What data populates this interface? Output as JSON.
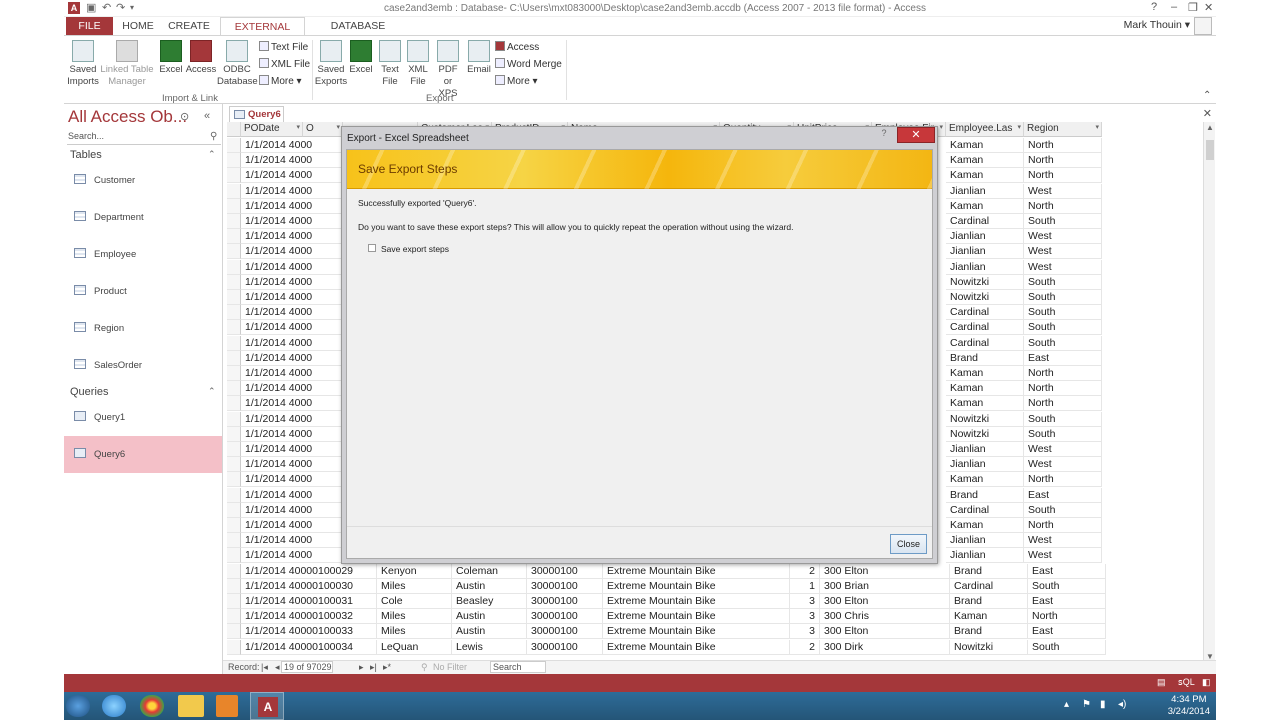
{
  "window": {
    "title": "case2and3emb : Database- C:\\Users\\mxt083000\\Desktop\\case2and3emb.accdb (Access 2007 - 2013 file format) - Access",
    "app_icon": "A",
    "help": "?",
    "min": "–",
    "restore": "❐",
    "close": "✕"
  },
  "ribbon_tabs": [
    {
      "label": "FILE"
    },
    {
      "label": "HOME"
    },
    {
      "label": "CREATE"
    },
    {
      "label": "EXTERNAL DATA"
    },
    {
      "label": "DATABASE TOOLS"
    }
  ],
  "user": {
    "name": "Mark Thouin ▾"
  },
  "ribbon": {
    "import": {
      "saved_imports": "Saved Imports",
      "linked_table_manager": "Linked Table Manager",
      "excel": "Excel",
      "access": "Access",
      "odbc": "ODBC Database",
      "text_file": "Text File",
      "xml_file": "XML File",
      "more": "More ▾",
      "group_label": "Import & Link"
    },
    "export": {
      "saved_exports": "Saved Exports",
      "excel": "Excel",
      "text_file": "Text File",
      "xml_file": "XML File",
      "pdf": "PDF or XPS",
      "email": "Email",
      "access": "Access",
      "word_merge": "Word Merge",
      "more": "More ▾",
      "group_label": "Export"
    }
  },
  "nav": {
    "header": "All Access Ob...",
    "search_placeholder": "Search...",
    "tables_label": "Tables",
    "tables": [
      "Customer",
      "Department",
      "Employee",
      "Product",
      "Region",
      "SalesOrder"
    ],
    "queries_label": "Queries",
    "queries": [
      "Query1",
      "Query6"
    ],
    "selected": "Query6"
  },
  "doc_tab": {
    "label": "Query6"
  },
  "grid": {
    "headers": [
      "PODate",
      "O",
      "",
      "Customer.Las",
      "ProductID",
      "Name",
      "Quantity",
      "UnitPrice",
      "Employee.Fir",
      "Employee.Las",
      "Region"
    ],
    "rows": [
      [
        "1/1/2014 4000",
        "",
        "",
        "",
        "",
        "",
        "",
        "",
        "",
        "Kaman",
        "North"
      ],
      [
        "1/1/2014 4000",
        "",
        "",
        "",
        "",
        "",
        "",
        "",
        "",
        "Kaman",
        "North"
      ],
      [
        "1/1/2014 4000",
        "",
        "",
        "",
        "",
        "",
        "",
        "",
        "",
        "Kaman",
        "North"
      ],
      [
        "1/1/2014 4000",
        "",
        "",
        "",
        "",
        "",
        "",
        "",
        "",
        "Jianlian",
        "West"
      ],
      [
        "1/1/2014 4000",
        "",
        "",
        "",
        "",
        "",
        "",
        "",
        "",
        "Kaman",
        "North"
      ],
      [
        "1/1/2014 4000",
        "",
        "",
        "",
        "",
        "",
        "",
        "",
        "",
        "Cardinal",
        "South"
      ],
      [
        "1/1/2014 4000",
        "",
        "",
        "",
        "",
        "",
        "",
        "",
        "",
        "Jianlian",
        "West"
      ],
      [
        "1/1/2014 4000",
        "",
        "",
        "",
        "",
        "",
        "",
        "",
        "",
        "Jianlian",
        "West"
      ],
      [
        "1/1/2014 4000",
        "",
        "",
        "",
        "",
        "",
        "",
        "",
        "",
        "Jianlian",
        "West"
      ],
      [
        "1/1/2014 4000",
        "",
        "",
        "",
        "",
        "",
        "",
        "",
        "",
        "Nowitzki",
        "South"
      ],
      [
        "1/1/2014 4000",
        "",
        "",
        "",
        "",
        "",
        "",
        "",
        "",
        "Nowitzki",
        "South"
      ],
      [
        "1/1/2014 4000",
        "",
        "",
        "",
        "",
        "",
        "",
        "",
        "",
        "Cardinal",
        "South"
      ],
      [
        "1/1/2014 4000",
        "",
        "",
        "",
        "",
        "",
        "",
        "",
        "",
        "Cardinal",
        "South"
      ],
      [
        "1/1/2014 4000",
        "",
        "",
        "",
        "",
        "",
        "",
        "",
        "",
        "Cardinal",
        "South"
      ],
      [
        "1/1/2014 4000",
        "",
        "",
        "",
        "",
        "",
        "",
        "",
        "",
        "Brand",
        "East"
      ],
      [
        "1/1/2014 4000",
        "",
        "",
        "",
        "",
        "",
        "",
        "",
        "",
        "Kaman",
        "North"
      ],
      [
        "1/1/2014 4000",
        "",
        "",
        "",
        "",
        "",
        "",
        "",
        "",
        "Kaman",
        "North"
      ],
      [
        "1/1/2014 4000",
        "",
        "",
        "",
        "",
        "",
        "",
        "",
        "",
        "Kaman",
        "North"
      ],
      [
        "1/1/2014 4000",
        "",
        "",
        "",
        "",
        "",
        "",
        "",
        "",
        "Nowitzki",
        "South"
      ],
      [
        "1/1/2014 4000",
        "",
        "",
        "",
        "",
        "",
        "",
        "",
        "",
        "Nowitzki",
        "South"
      ],
      [
        "1/1/2014 4000",
        "",
        "",
        "",
        "",
        "",
        "",
        "",
        "",
        "Jianlian",
        "West"
      ],
      [
        "1/1/2014 4000",
        "",
        "",
        "",
        "",
        "",
        "",
        "",
        "",
        "Jianlian",
        "West"
      ],
      [
        "1/1/2014 4000",
        "",
        "",
        "",
        "",
        "",
        "",
        "",
        "",
        "Kaman",
        "North"
      ],
      [
        "1/1/2014 4000",
        "",
        "",
        "",
        "",
        "",
        "",
        "",
        "",
        "Brand",
        "East"
      ],
      [
        "1/1/2014 4000",
        "",
        "",
        "",
        "",
        "",
        "",
        "",
        "",
        "Cardinal",
        "South"
      ],
      [
        "1/1/2014 4000",
        "",
        "",
        "",
        "",
        "",
        "",
        "",
        "",
        "Kaman",
        "North"
      ],
      [
        "1/1/2014 4000",
        "",
        "",
        "",
        "",
        "",
        "",
        "",
        "",
        "Jianlian",
        "West"
      ],
      [
        "1/1/2014 4000",
        "",
        "",
        "",
        "",
        "",
        "",
        "",
        "",
        "Jianlian",
        "West"
      ],
      [
        "1/1/2014 40000100029",
        "Kenyon",
        "Coleman",
        "30000100",
        "Extreme Mountain Bike",
        "2",
        "300",
        "Elton",
        "Brand",
        "East",
        ""
      ],
      [
        "1/1/2014 40000100030",
        "Miles",
        "Austin",
        "30000100",
        "Extreme Mountain Bike",
        "1",
        "300",
        "Brian",
        "Cardinal",
        "South",
        ""
      ],
      [
        "1/1/2014 40000100031",
        "Cole",
        "Beasley",
        "30000100",
        "Extreme Mountain Bike",
        "3",
        "300",
        "Elton",
        "Brand",
        "East",
        ""
      ],
      [
        "1/1/2014 40000100032",
        "Miles",
        "Austin",
        "30000100",
        "Extreme Mountain Bike",
        "3",
        "300",
        "Chris",
        "Kaman",
        "North",
        ""
      ],
      [
        "1/1/2014 40000100033",
        "Miles",
        "Austin",
        "30000100",
        "Extreme Mountain Bike",
        "3",
        "300",
        "Elton",
        "Brand",
        "East",
        ""
      ],
      [
        "1/1/2014 40000100034",
        "LeQuan",
        "Lewis",
        "30000100",
        "Extreme Mountain Bike",
        "2",
        "300",
        "Dirk",
        "Nowitzki",
        "South",
        ""
      ]
    ]
  },
  "record_nav": {
    "label": "Record:",
    "position": "19 of 97029",
    "filter": "No Filter",
    "search": "Search"
  },
  "dialog": {
    "title": "Export - Excel Spreadsheet",
    "help": "?",
    "close": "✕",
    "banner_title": "Save Export Steps",
    "message1": "Successfully exported 'Query6'.",
    "message2": "Do you want to save these export steps? This will allow you to quickly repeat the operation without using the wizard.",
    "checkbox_label": "Save export steps",
    "close_button": "Close"
  },
  "taskbar": {
    "time": "4:34 PM",
    "date": "3/24/2014"
  },
  "colors": {
    "accent": "#a4373a",
    "banner": "#f6c42a",
    "taskbar": "#2b6591"
  }
}
